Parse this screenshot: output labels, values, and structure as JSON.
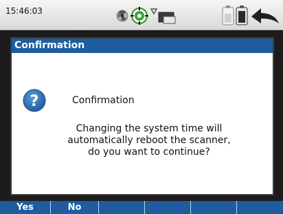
{
  "status_bar": {
    "time": "15:46:03",
    "icons": [
      "fan-icon",
      "gps-target-icon",
      "signal-icon",
      "card-icon"
    ],
    "right_icons": [
      "battery-icon",
      "battery-icon",
      "back-arrow-icon"
    ]
  },
  "dialog": {
    "title": "Confirmation",
    "heading": "Confirmation",
    "message": "Changing the system time will automatically reboot the scanner, do you want to continue?",
    "icon": "question-icon"
  },
  "softkeys": [
    {
      "label": "Yes"
    },
    {
      "label": "No"
    },
    {
      "label": ""
    },
    {
      "label": ""
    },
    {
      "label": ""
    },
    {
      "label": ""
    }
  ],
  "colors": {
    "accent": "#1e5c9e",
    "title_text": "#ffffff",
    "icon_blue": "#2a6fb5",
    "gps_green": "#3aa53a"
  }
}
